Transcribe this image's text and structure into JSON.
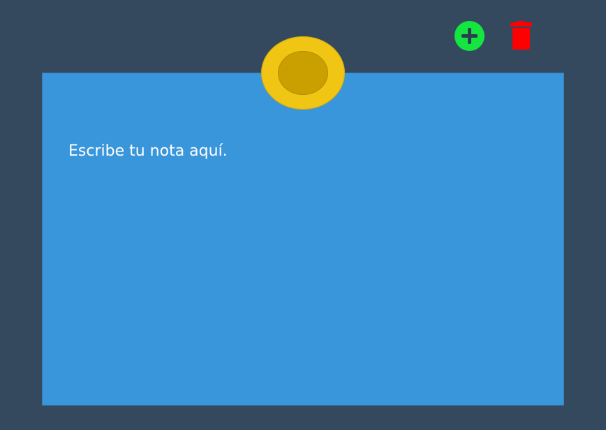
{
  "toolbar": {
    "add_icon": "plus-circle-icon",
    "delete_icon": "trash-icon"
  },
  "note": {
    "text": "Escribe tu nota aquí.",
    "pin_icon": "pushpin-icon"
  },
  "colors": {
    "background": "#34495e",
    "note": "#3a96db",
    "pin_outer": "#f0c514",
    "pin_inner": "#c9a000",
    "add": "#14e63f",
    "delete": "#ff0000"
  }
}
